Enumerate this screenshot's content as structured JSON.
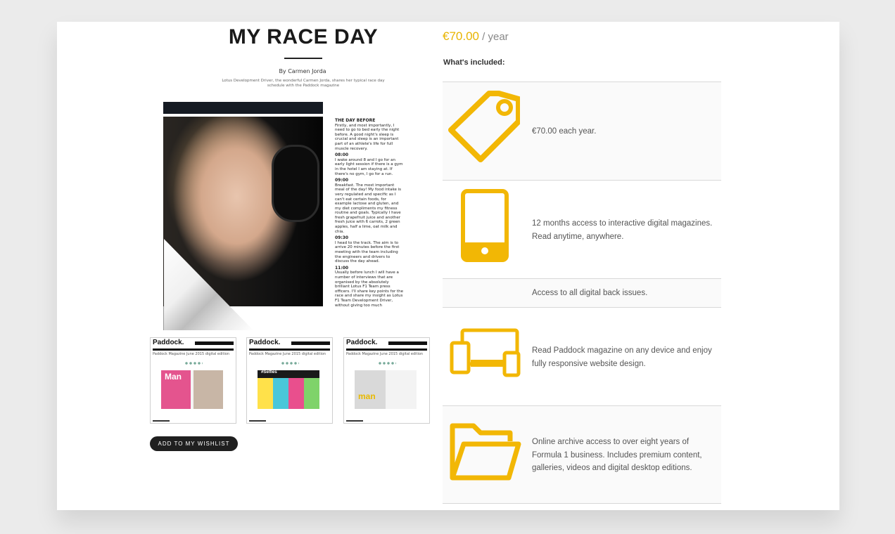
{
  "magazine": {
    "title": "MY RACE DAY",
    "byline": "By Carmen Jorda",
    "intro": "Lotus Development Driver, the wonderful Carmen Jorda, shares her typical race day schedule with the Paddock magazine",
    "article": [
      {
        "heading": "THE DAY BEFORE",
        "text": "Firstly, and most importantly, I need to go to bed early the night before. A good night's sleep is crucial and sleep is an important part of an athlete's life for full muscle recovery."
      },
      {
        "heading": "08:00",
        "text": "I wake around 8 and I go for an early light session if there is a gym in the hotel I am staying at. If there's no gym, I go for a run."
      },
      {
        "heading": "09:00",
        "text": "Breakfast. The most important meal of the day! My food intake is very regulated and specific as I can't eat certain foods, for example lactose and gluten, and my diet compliments my fitness routine and goals. Typically I have fresh grapefruit juice and another fresh juice with 6 carrots, 2 green apples, half a lime, oat milk and chia."
      },
      {
        "heading": "09:30",
        "text": "I head to the track. The aim is to arrive 20 minutes before the first meeting with the team including the engineers and drivers to discuss the day ahead."
      },
      {
        "heading": "11:00",
        "text": "Usually before lunch I will have a number of interviews that are organised by the absolutely brilliant Lotus F1 Team press officers. I'll share key points for the race and share my insight as Lotus F1 Team Development Driver, without giving too much"
      }
    ],
    "thumbnails": [
      {
        "brand": "Paddock.",
        "caption": "Paddock Magazine June 2015 digital edition",
        "spread": "Man"
      },
      {
        "brand": "Paddock.",
        "caption": "Paddock Magazine June 2015 digital edition",
        "spread": "#Selfies"
      },
      {
        "brand": "Paddock.",
        "caption": "Paddock Magazine June 2015 digital edition",
        "spread": "man"
      }
    ],
    "wishlist_label": "ADD TO MY WISHLIST"
  },
  "pricing": {
    "price": "€70.00",
    "period": " / year",
    "included_heading": "What's included:",
    "accent_color": "#F2B705",
    "features": [
      {
        "icon": "price-tag-icon",
        "text": "€70.00 each year."
      },
      {
        "icon": "tablet-icon",
        "text": "12 months access to interactive digital magazines. Read anytime, anywhere."
      },
      {
        "icon": "",
        "text": "Access to all digital back issues."
      },
      {
        "icon": "multi-device-icon",
        "text": "Read Paddock magazine on any device and enjoy fully responsive website design."
      },
      {
        "icon": "folder-icon",
        "text": "Online archive access to over eight years of Formula 1 business. Includes premium content, galleries, videos and digital desktop editions."
      }
    ]
  }
}
